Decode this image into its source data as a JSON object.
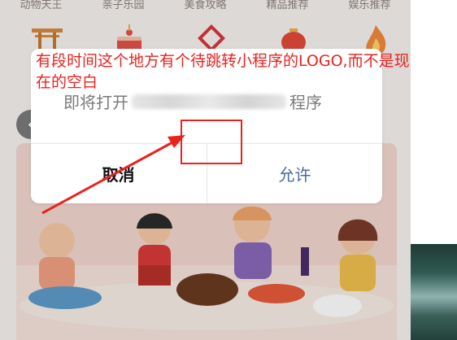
{
  "top_categories": [
    "动物天王",
    "亲子乐园",
    "美食攻略",
    "精品推荐",
    "娱乐推荐"
  ],
  "icons": [
    {
      "name": "torii-gate-icon",
      "color": "#e0a150"
    },
    {
      "name": "cake-icon",
      "color": "#e2524a"
    },
    {
      "name": "chinese-knot-icon",
      "color": "#d9363e"
    },
    {
      "name": "lantern-icon",
      "color": "#e24a3a"
    },
    {
      "name": "flame-icon",
      "color": "#f08a3c"
    }
  ],
  "annotation": {
    "text": "有段时间这个地方有个待跳转小程序的LOGO,而不是现在的空白",
    "color": "#e8231f"
  },
  "dialog": {
    "message_prefix": "即将打开",
    "message_suffix": "程序",
    "cancel_label": "取消",
    "allow_label": "允许"
  },
  "colors": {
    "annotation_red": "#e8231f",
    "allow_blue": "#4a6aa0",
    "card_bg": "#f2d6cf"
  }
}
